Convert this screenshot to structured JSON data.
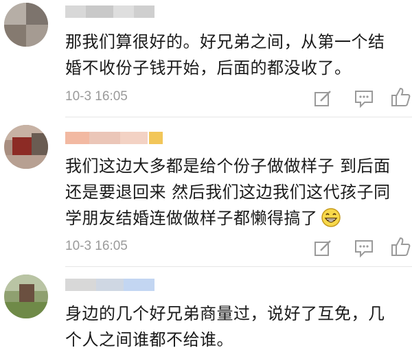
{
  "comments": [
    {
      "text_lines": [
        "那我们算很好的。好兄弟之间，从第一个结",
        "婚不收份子钱开始，后面的都没收了。"
      ],
      "timestamp": "10-3 16:05",
      "actions": [
        "compose-icon",
        "comment-icon",
        "like-icon"
      ]
    },
    {
      "text_lines": [
        "我们这边大多都是给个份子做做样子 到后面",
        "还是要退回来 然后我们这边我们这代孩子同",
        "学朋友结婚连做做样子都懒得搞了"
      ],
      "timestamp": "10-3 16:05",
      "actions": [
        "compose-icon",
        "comment-icon",
        "like-icon"
      ],
      "emoji": "grin-emoji"
    },
    {
      "text_lines": [
        "身边的几个好兄弟商量过，说好了互免，几",
        "个人之间谁都不给谁。"
      ]
    }
  ],
  "colors": {
    "text": "#1a1a1a",
    "time": "#9a9a9a",
    "icon": "#9a9a9a"
  }
}
